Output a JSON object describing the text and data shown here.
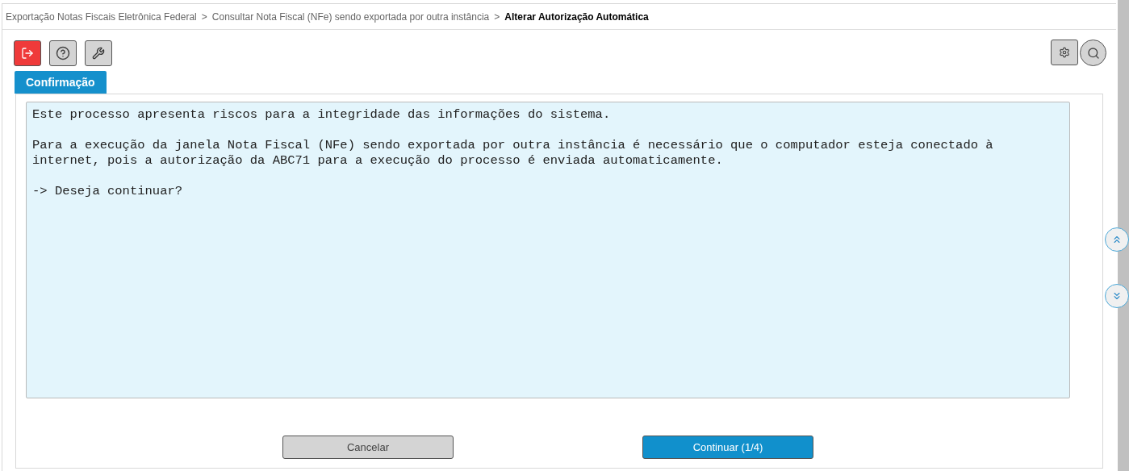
{
  "breadcrumb": [
    {
      "label": "Exportação Notas Fiscais Eletrônica Federal",
      "current": false
    },
    {
      "label": "Consultar Nota Fiscal (NFe) sendo exportada por outra instância",
      "current": false
    },
    {
      "label": "Alterar Autorização Automática",
      "current": true
    }
  ],
  "breadcrumb_separator": ">",
  "tabs": [
    {
      "label": "Confirmação",
      "selected": true
    }
  ],
  "message": {
    "paragraphs": [
      [
        "Este processo apresenta riscos para a integridade das informações do sistema."
      ],
      [
        "Para a execução da janela Nota Fiscal (NFe) sendo exportada por outra instância é necessário que o computador esteja conectado à",
        "internet, pois a autorização da ABC71 para a execução do processo é enviada automaticamente."
      ],
      [
        "-> Deseja continuar?"
      ]
    ]
  },
  "buttons": [
    {
      "label": "Cancelar",
      "kind": "secondary"
    },
    {
      "label": "Continuar (1/4)",
      "kind": "primary"
    }
  ]
}
